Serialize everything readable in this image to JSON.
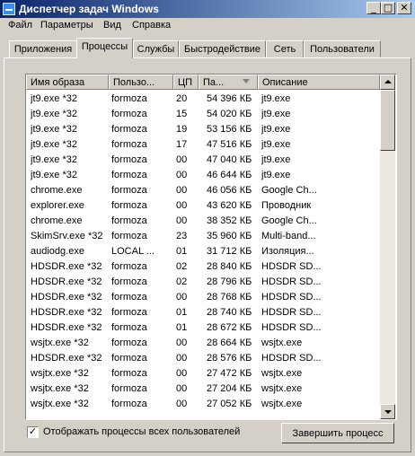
{
  "window": {
    "title": "Диспетчер задач Windows",
    "minimize": "_",
    "maximize": "□",
    "close": "✕"
  },
  "menu": [
    "Файл",
    "Параметры",
    "Вид",
    "Справка"
  ],
  "tabs": [
    "Приложения",
    "Процессы",
    "Службы",
    "Быстродействие",
    "Сеть",
    "Пользователи"
  ],
  "active_tab": "Процессы",
  "columns": [
    "Имя образа",
    "Пользо...",
    "ЦП",
    "Па...",
    "Описание"
  ],
  "sort_column": "Па...",
  "rows": [
    [
      "jt9.exe *32",
      "formoza",
      "20",
      "54 396 КБ",
      "jt9.exe"
    ],
    [
      "jt9.exe *32",
      "formoza",
      "15",
      "54 020 КБ",
      "jt9.exe"
    ],
    [
      "jt9.exe *32",
      "formoza",
      "19",
      "53 156 КБ",
      "jt9.exe"
    ],
    [
      "jt9.exe *32",
      "formoza",
      "17",
      "47 516 КБ",
      "jt9.exe"
    ],
    [
      "jt9.exe *32",
      "formoza",
      "00",
      "47 040 КБ",
      "jt9.exe"
    ],
    [
      "jt9.exe *32",
      "formoza",
      "00",
      "46 644 КБ",
      "jt9.exe"
    ],
    [
      "chrome.exe",
      "formoza",
      "00",
      "46 056 КБ",
      "Google Ch..."
    ],
    [
      "explorer.exe",
      "formoza",
      "00",
      "43 620 КБ",
      "Проводник"
    ],
    [
      "chrome.exe",
      "formoza",
      "00",
      "38 352 КБ",
      "Google Ch..."
    ],
    [
      "SkimSrv.exe *32",
      "formoza",
      "23",
      "35 960 КБ",
      "Multi-band..."
    ],
    [
      "audiodg.exe",
      "LOCAL ...",
      "01",
      "31 712 КБ",
      "Изоляция..."
    ],
    [
      "HDSDR.exe *32",
      "formoza",
      "02",
      "28 840 КБ",
      "HDSDR SD..."
    ],
    [
      "HDSDR.exe *32",
      "formoza",
      "02",
      "28 796 КБ",
      "HDSDR SD..."
    ],
    [
      "HDSDR.exe *32",
      "formoza",
      "00",
      "28 768 КБ",
      "HDSDR SD..."
    ],
    [
      "HDSDR.exe *32",
      "formoza",
      "01",
      "28 740 КБ",
      "HDSDR SD..."
    ],
    [
      "HDSDR.exe *32",
      "formoza",
      "01",
      "28 672 КБ",
      "HDSDR SD..."
    ],
    [
      "wsjtx.exe *32",
      "formoza",
      "00",
      "28 664 КБ",
      "wsjtx.exe"
    ],
    [
      "HDSDR.exe *32",
      "formoza",
      "00",
      "28 576 КБ",
      "HDSDR SD..."
    ],
    [
      "wsjtx.exe *32",
      "formoza",
      "00",
      "27 472 КБ",
      "wsjtx.exe"
    ],
    [
      "wsjtx.exe *32",
      "formoza",
      "00",
      "27 204 КБ",
      "wsjtx.exe"
    ],
    [
      "wsjtx.exe *32",
      "formoza",
      "00",
      "27 052 КБ",
      "wsjtx.exe"
    ]
  ],
  "show_all_label": "Отображать процессы всех пользователей",
  "show_all_checked": "✓",
  "end_process_label": "Завершить процесс"
}
